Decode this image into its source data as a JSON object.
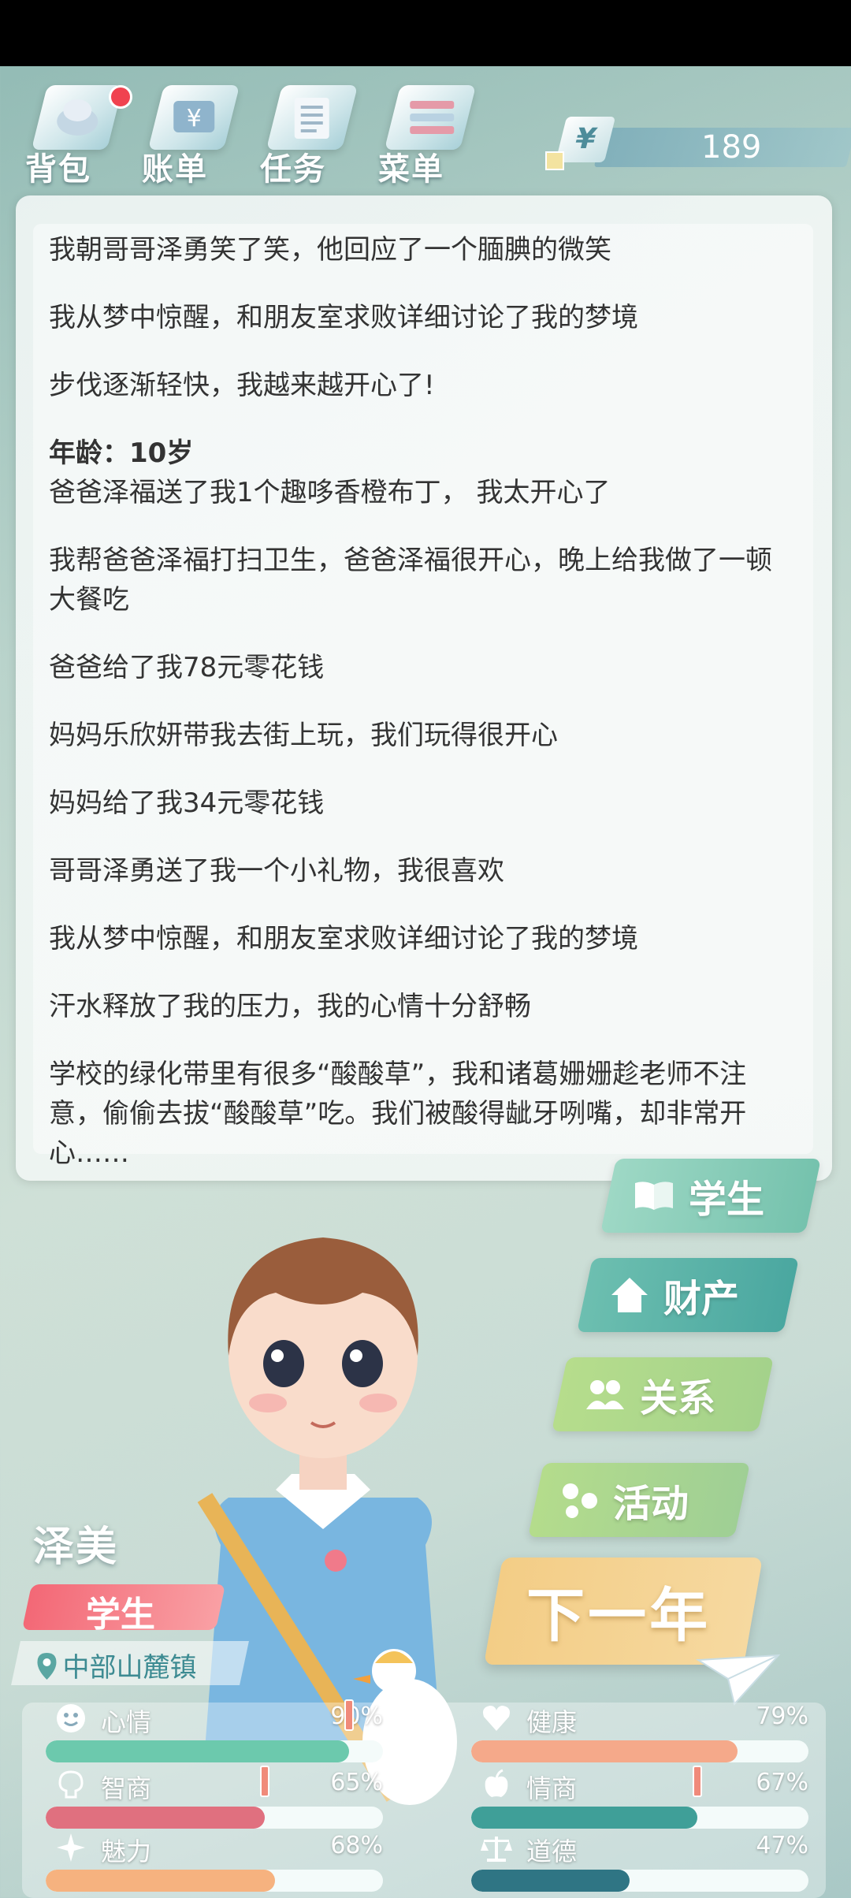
{
  "toolbar": {
    "backpack": "背包",
    "bill": "账单",
    "task": "任务",
    "menu": "菜单",
    "money_symbol": "¥",
    "money": "189"
  },
  "log": [
    "我朝哥哥泽勇笑了笑，他回应了一个腼腆的微笑",
    "我从梦中惊醒，和朋友室求败详细讨论了我的梦境",
    "步伐逐渐轻快，我越来越开心了!",
    "年龄：10岁",
    "爸爸泽福送了我1个趣哆香橙布丁， 我太开心了",
    "我帮爸爸泽福打扫卫生，爸爸泽福很开心，晚上给我做了一顿大餐吃",
    "爸爸给了我78元零花钱",
    "妈妈乐欣妍带我去街上玩，我们玩得很开心",
    "妈妈给了我34元零花钱",
    "哥哥泽勇送了我一个小礼物，我很喜欢",
    "我从梦中惊醒，和朋友室求败详细讨论了我的梦境",
    "汗水释放了我的压力，我的心情十分舒畅",
    "学校的绿化带里有很多“酸酸草”，我和诸葛姗姗趁老师不注意，偷偷去拔“酸酸草”吃。我们被酸得龇牙咧嘴，却非常开心……"
  ],
  "actions": {
    "student": "学生",
    "property": "财产",
    "relation": "关系",
    "activity": "活动",
    "next_year": "下一年"
  },
  "character": {
    "name": "泽美",
    "role": "学生",
    "location": "中部山麓镇"
  },
  "stats": {
    "mood": {
      "label": "心情",
      "pct": "90%",
      "value": 0.9,
      "color": "#6cc9ad"
    },
    "health": {
      "label": "健康",
      "pct": "79%",
      "value": 0.79,
      "color": "#f5a98a"
    },
    "iq": {
      "label": "智商",
      "pct": "65%",
      "value": 0.65,
      "color": "#e0707f"
    },
    "eq": {
      "label": "情商",
      "pct": "67%",
      "value": 0.67,
      "color": "#3f9f98"
    },
    "charm": {
      "label": "魅力",
      "pct": "68%",
      "value": 0.68,
      "color": "#f6b27f"
    },
    "morality": {
      "label": "道德",
      "pct": "47%",
      "value": 0.47,
      "color": "#2f7584"
    }
  },
  "icons": [
    "backpack-icon",
    "bill-icon",
    "task-icon",
    "menu-icon",
    "book-icon",
    "house-icon",
    "people-icon",
    "molecule-icon",
    "location-pin-icon",
    "smile-icon",
    "heart-icon",
    "brain-icon",
    "apple-icon",
    "sparkle-icon",
    "scales-icon",
    "paper-plane-icon"
  ]
}
